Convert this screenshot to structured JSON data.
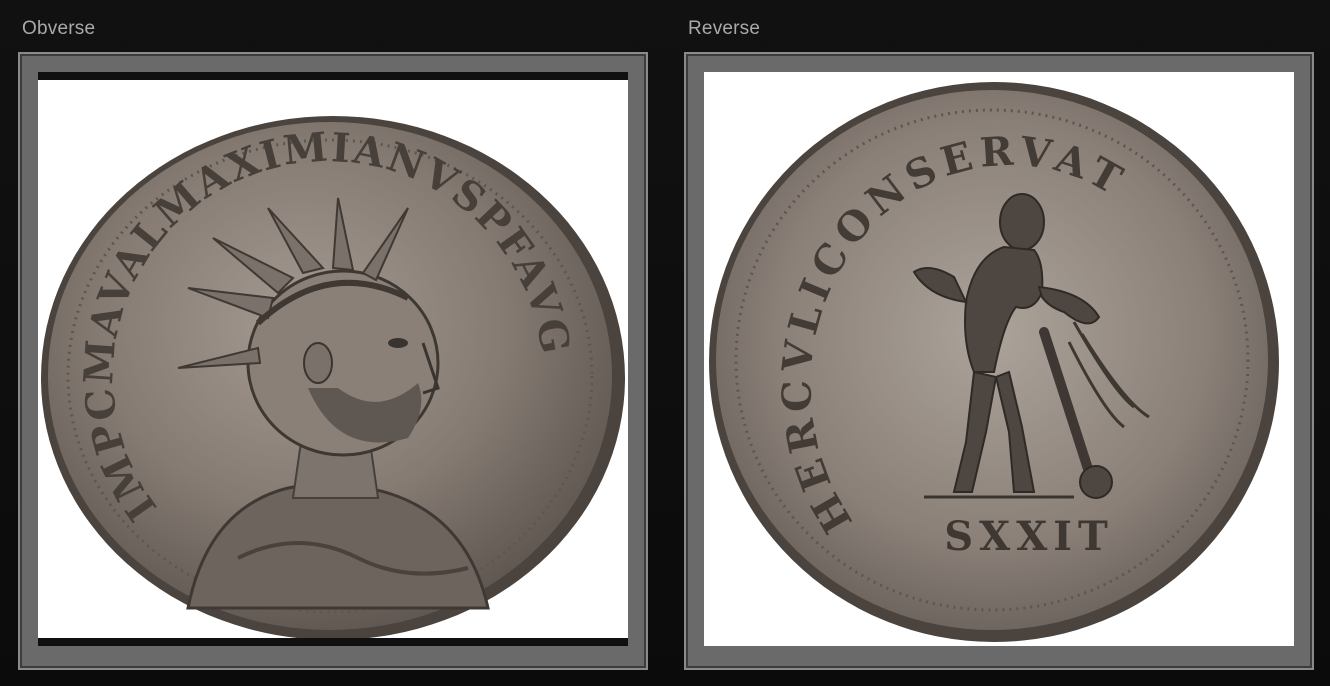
{
  "panels": {
    "obverse": {
      "label": "Obverse",
      "legend": "IMPCMAVALMAXIMIANVSPFAVG"
    },
    "reverse": {
      "label": "Reverse",
      "legend": "HERCVLICONSERVAT",
      "exergue": "SXXIT"
    }
  },
  "colors": {
    "page_bg": "#0d0d0d",
    "label": "#a9a9a9",
    "frame": "#6a6a6a",
    "viewport": "#ffffff",
    "coin_base": "#8b8179",
    "coin_dark": "#3a3430",
    "coin_light": "#b4aaa1"
  }
}
